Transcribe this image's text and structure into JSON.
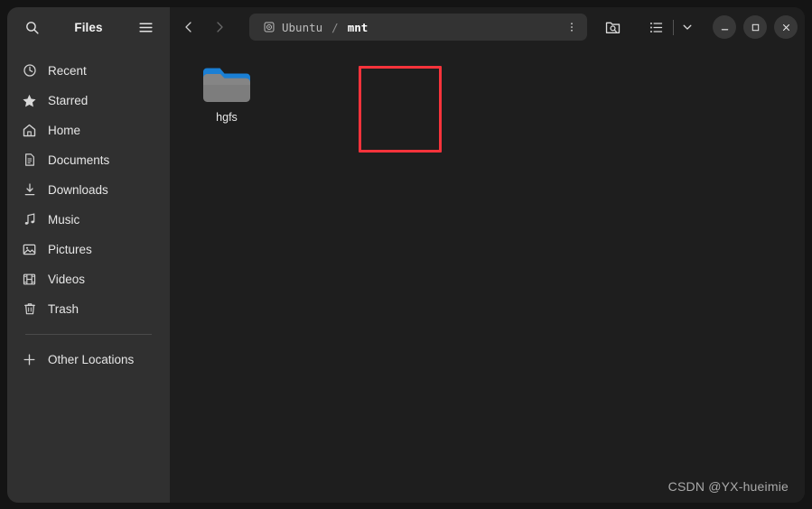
{
  "window": {
    "app_title": "Files"
  },
  "sidebar": {
    "search_icon": "search-icon",
    "menu_icon": "hamburger-menu-icon",
    "items": [
      {
        "label": "Recent",
        "icon": "clock-icon"
      },
      {
        "label": "Starred",
        "icon": "star-icon"
      },
      {
        "label": "Home",
        "icon": "home-icon"
      },
      {
        "label": "Documents",
        "icon": "document-icon"
      },
      {
        "label": "Downloads",
        "icon": "download-icon"
      },
      {
        "label": "Music",
        "icon": "music-note-icon"
      },
      {
        "label": "Pictures",
        "icon": "image-icon"
      },
      {
        "label": "Videos",
        "icon": "film-icon"
      },
      {
        "label": "Trash",
        "icon": "trash-icon"
      }
    ],
    "other_locations": {
      "label": "Other Locations",
      "icon": "plus-icon"
    }
  },
  "toolbar": {
    "back_icon": "chevron-left-icon",
    "forward_icon": "chevron-right-icon",
    "breadcrumb": [
      {
        "label": "Ubuntu",
        "icon": "hard-disk-icon",
        "current": false
      },
      {
        "label": "mnt",
        "icon": "",
        "current": true
      }
    ],
    "separator": "/",
    "path_menu_icon": "three-dots-vertical-icon",
    "search_folder_icon": "folder-search-icon",
    "list_view_icon": "list-view-icon",
    "view_options_icon": "chevron-down-icon",
    "minimize_icon": "minimize-icon",
    "maximize_icon": "maximize-icon",
    "close_icon": "close-icon"
  },
  "files": [
    {
      "name": "hgfs",
      "type": "folder",
      "tab_color": "#1a7fd4",
      "body_color": "#7d7d7d"
    }
  ],
  "annotation": {
    "color": "#f7333b",
    "target": "hgfs"
  },
  "watermark": {
    "text": "CSDN @YX-hueimie"
  },
  "colors": {
    "sidebar_bg": "#303030",
    "main_bg": "#1e1e1e",
    "desktop_bg": "#141414",
    "pathbar_bg": "#333333",
    "accent_red": "#f7333b"
  }
}
